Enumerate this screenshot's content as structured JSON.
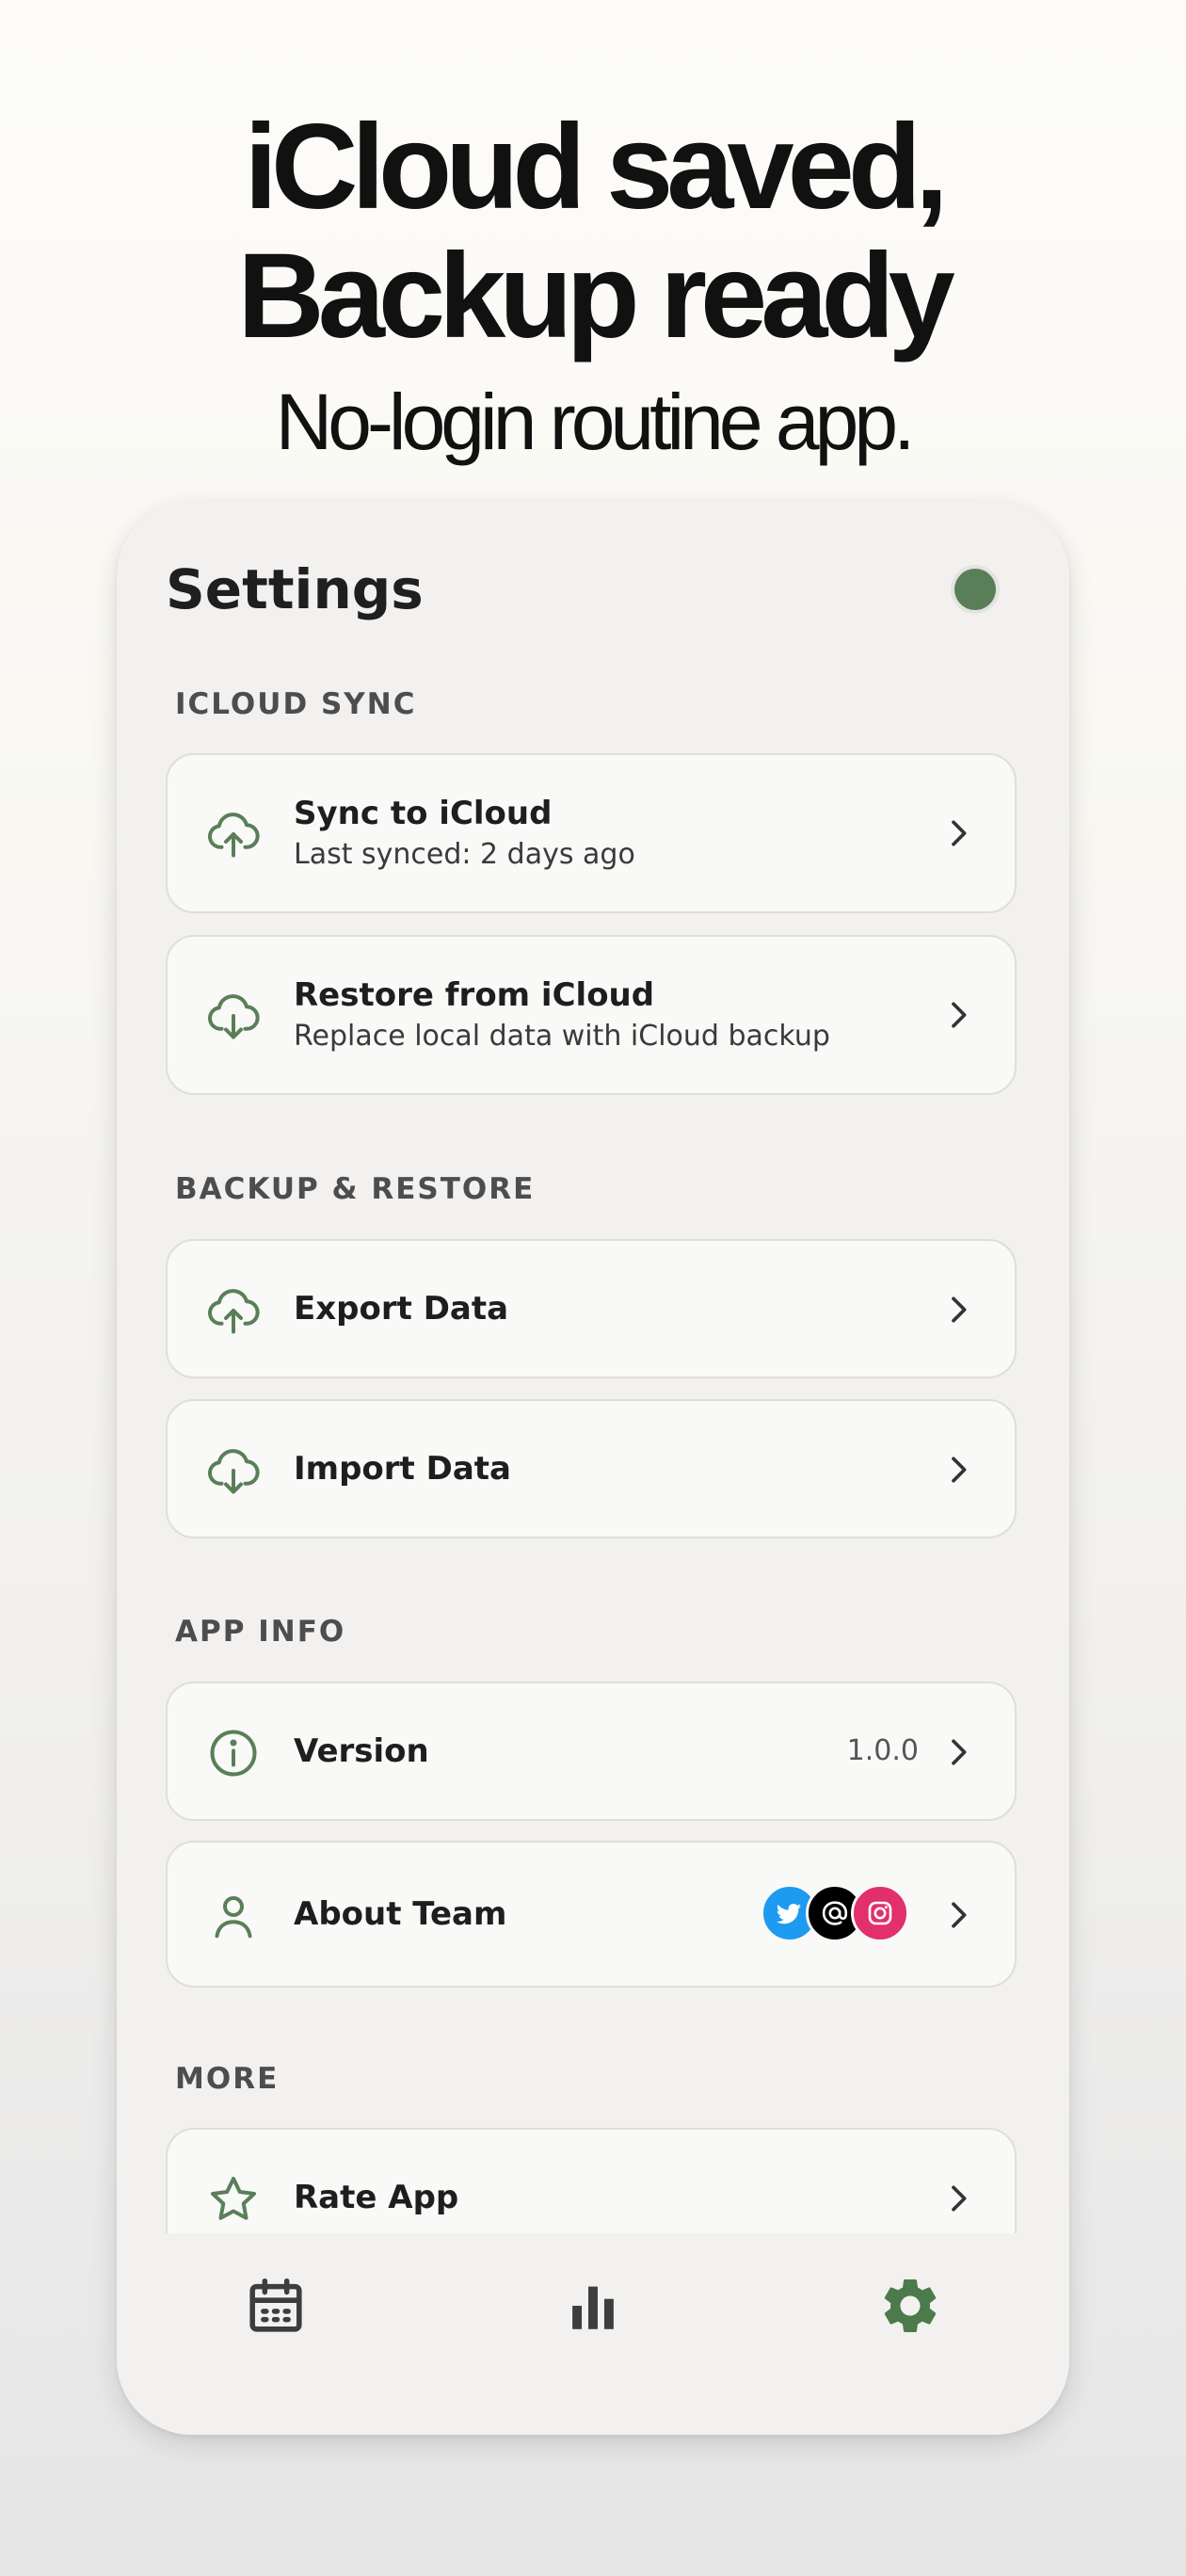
{
  "hero": {
    "line1": "iCloud saved,",
    "line2": "Backup ready",
    "subtitle": "No-login routine app."
  },
  "screen": {
    "title": "Settings",
    "status_dot_color": "#5a7f58"
  },
  "sections": {
    "icloud_sync": {
      "label": "ICLOUD SYNC",
      "sync": {
        "title": "Sync to iCloud",
        "subtitle": "Last synced: 2 days ago",
        "icon": "cloud-upload-icon"
      },
      "restore": {
        "title": "Restore from iCloud",
        "subtitle": "Replace local data with iCloud backup",
        "icon": "cloud-download-icon"
      }
    },
    "backup_restore": {
      "label": "BACKUP & RESTORE",
      "export": {
        "title": "Export Data",
        "icon": "cloud-upload-icon"
      },
      "import": {
        "title": "Import Data",
        "icon": "cloud-download-icon"
      }
    },
    "app_info": {
      "label": "APP INFO",
      "version": {
        "title": "Version",
        "value": "1.0.0",
        "icon": "info-icon"
      },
      "about": {
        "title": "About Team",
        "icon": "person-icon",
        "socials": [
          "twitter-icon",
          "threads-icon",
          "instagram-icon"
        ]
      }
    },
    "more": {
      "label": "MORE",
      "rate": {
        "title": "Rate App",
        "icon": "star-icon"
      }
    }
  },
  "tabs": [
    {
      "name": "calendar-icon",
      "active": false
    },
    {
      "name": "bar-chart-icon",
      "active": false
    },
    {
      "name": "gear-icon",
      "active": true
    }
  ],
  "colors": {
    "accent": "#5a7f58",
    "twitter": "#1d9bf0",
    "threads": "#000000",
    "instagram": "#e1306c",
    "tab_inactive": "#3d3d3d"
  }
}
